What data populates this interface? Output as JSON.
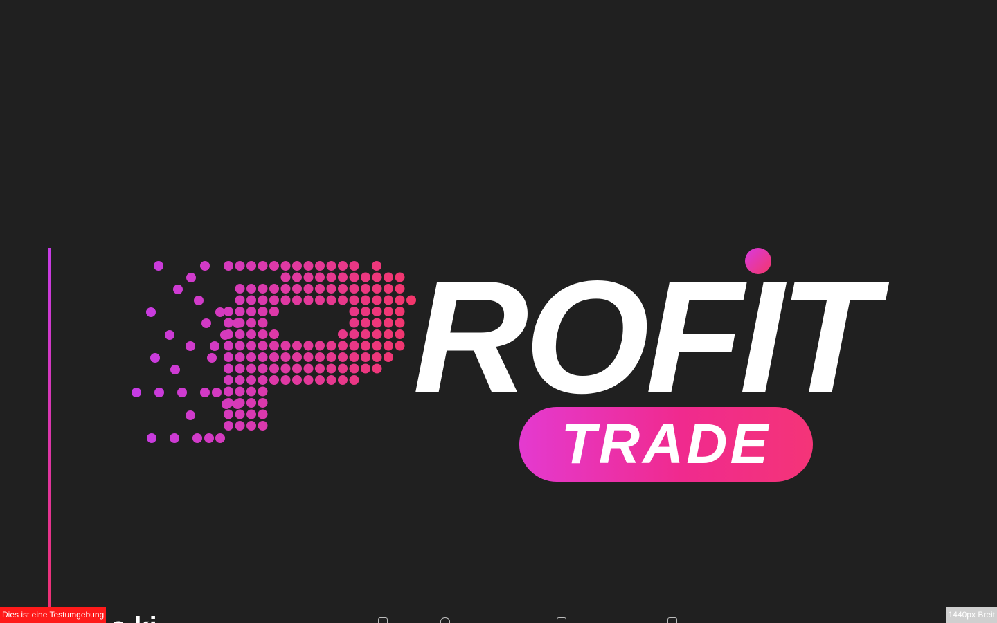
{
  "logo": {
    "wordmark": "ROFIT",
    "badge_text": "TRADE",
    "colors": {
      "background": "#202020",
      "magenta": "#c63ce6",
      "pink": "#f4366a",
      "white": "#ffffff"
    },
    "icons": {
      "mark": "dotted-p-logo-icon",
      "dot": "i-dot-icon"
    }
  },
  "navigation": {
    "peek_text": "a ki"
  },
  "environment_badge": {
    "label": "Dies ist eine Testumgebung"
  },
  "viewport_badge": {
    "label": "1440px Breit"
  }
}
